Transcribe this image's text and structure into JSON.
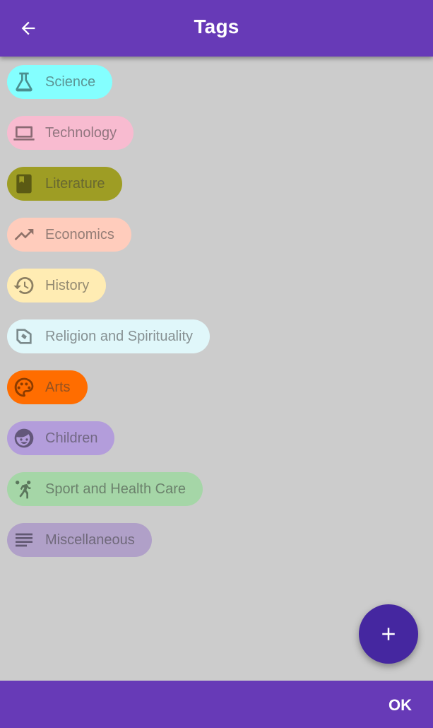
{
  "app_bar": {
    "title": "Tags",
    "back_icon": "arrow-back-icon"
  },
  "tags": [
    {
      "label": "Science",
      "icon": "flask-icon",
      "bg": "#84ffff",
      "icon_color": "#4a8f8f"
    },
    {
      "label": "Technology",
      "icon": "laptop-icon",
      "bg": "#f8bbd0",
      "icon_color": "#8a6a74"
    },
    {
      "label": "Literature",
      "icon": "book-icon",
      "bg": "#9e9d24",
      "icon_color": "#5b5a14"
    },
    {
      "label": "Economics",
      "icon": "trending-up-icon",
      "bg": "#ffccbc",
      "icon_color": "#8e7168"
    },
    {
      "label": "History",
      "icon": "history-icon",
      "bg": "#ffecb3",
      "icon_color": "#8b7f62"
    },
    {
      "label": "Religion and Spirituality",
      "icon": "pray-icon",
      "bg": "#e0f7fa",
      "icon_color": "#7b8a8c"
    },
    {
      "label": "Arts",
      "icon": "palette-icon",
      "bg": "#ff6d00",
      "icon_color": "#8c3c00"
    },
    {
      "label": "Children",
      "icon": "child-face-icon",
      "bg": "#b39ddb",
      "icon_color": "#63577a"
    },
    {
      "label": "Sport and Health Care",
      "icon": "basketball-player-icon",
      "bg": "#a5d6a7",
      "icon_color": "#5a765c"
    },
    {
      "label": "Miscellaneous",
      "icon": "notes-icon",
      "bg": "#b0a0c8",
      "icon_color": "#615872"
    }
  ],
  "fab": {
    "icon": "plus-icon"
  },
  "bottom_bar": {
    "ok_label": "OK"
  }
}
